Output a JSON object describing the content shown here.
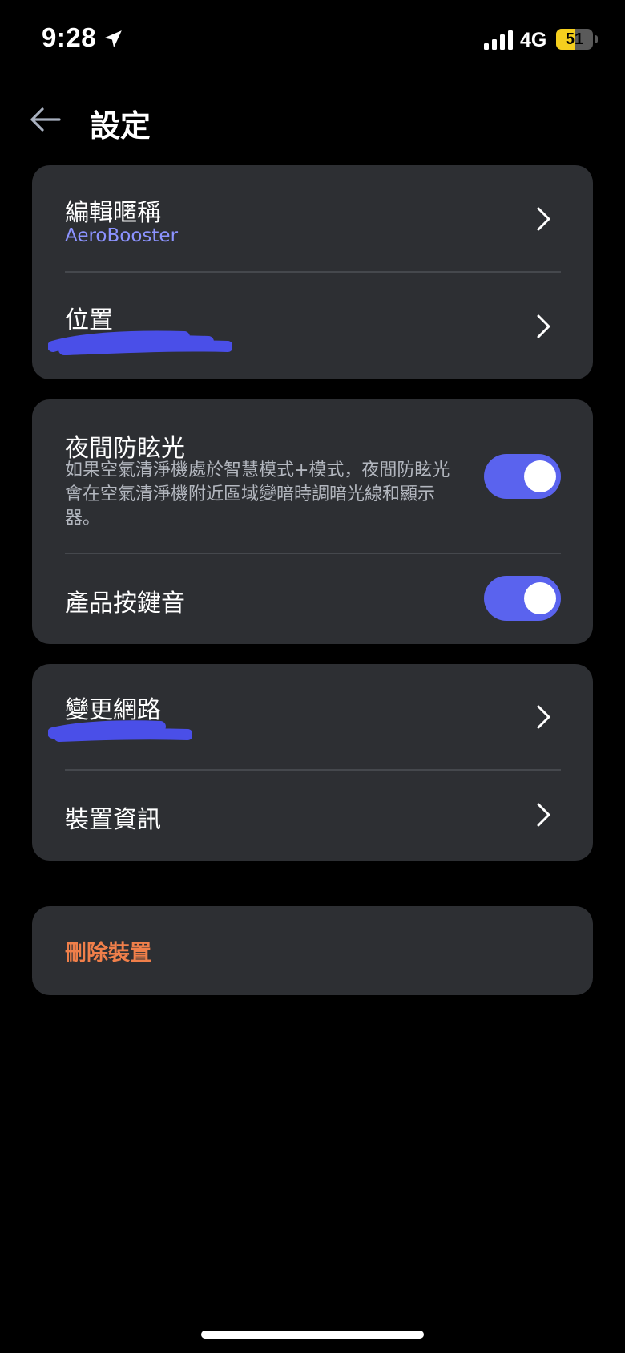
{
  "status_bar": {
    "time": "9:28",
    "network": "4G",
    "battery": "51",
    "battery_level": 0.51,
    "icons": [
      "location-arrow-icon",
      "cellular-signal-icon",
      "battery-icon"
    ]
  },
  "header": {
    "title": "設定",
    "back_icon": "arrow-left-icon"
  },
  "device_card": {
    "nickname": {
      "label": "編輯暱稱",
      "value": "AeroBooster"
    },
    "location": {
      "label": "位置"
    }
  },
  "settings_card": {
    "night_glare": {
      "label": "夜間防眩光",
      "description": "如果空氣清淨機處於智慧模式+模式，夜間防眩光會在空氣清淨機附近區域變暗時調暗光線和顯示器。",
      "enabled": true
    },
    "key_sound": {
      "label": "產品按鍵音",
      "enabled": true
    }
  },
  "network_card": {
    "change_network": {
      "label": "變更網路"
    },
    "device_info": {
      "label": "裝置資訊"
    }
  },
  "danger_card": {
    "delete_label": "刪除裝置"
  },
  "colors": {
    "background": "#000000",
    "card": "#2d2f33",
    "accent": "#5a63ee",
    "subtitle": "#8c93ff",
    "danger": "#f07f4a",
    "redaction": "#4a4fe8"
  }
}
